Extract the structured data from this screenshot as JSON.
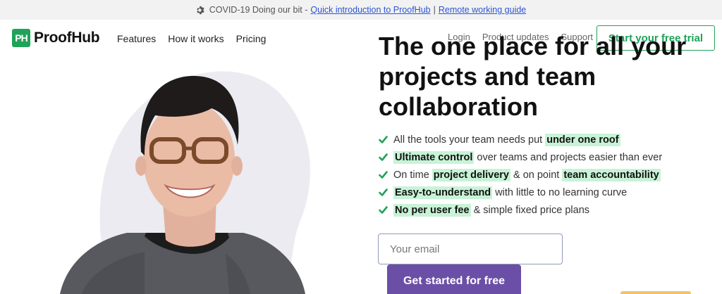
{
  "announcement": {
    "icon": "gear-icon",
    "text": "COVID-19 Doing our bit -",
    "link1": "Quick introduction to ProofHub",
    "separator": "|",
    "link2": "Remote working guide"
  },
  "brand": {
    "badge": "PH",
    "name": "ProofHub",
    "color": "#1fa35a"
  },
  "nav": {
    "items": [
      "Features",
      "How it works",
      "Pricing"
    ]
  },
  "right_nav": {
    "items": [
      "Login",
      "Product updates",
      "Support"
    ],
    "trial_button": "Start your free trial"
  },
  "hero": {
    "title": "The one place for all your projects and team collaboration",
    "features": [
      {
        "before": "All the tools your team needs put ",
        "highlight": "under one roof",
        "after": "",
        "highlight2": "",
        "after2": ""
      },
      {
        "before": "",
        "highlight": "Ultimate control",
        "after": " over teams and projects easier than ever",
        "highlight2": "",
        "after2": ""
      },
      {
        "before": "On time ",
        "highlight": "project delivery",
        "after": " & on point ",
        "highlight2": "team accountability",
        "after2": ""
      },
      {
        "before": "",
        "highlight": "Easy-to-understand",
        "after": " with little to no learning curve",
        "highlight2": "",
        "after2": ""
      },
      {
        "before": "",
        "highlight": "No per user fee",
        "after": " & simple fixed price plans",
        "highlight2": "",
        "after2": ""
      }
    ],
    "email_placeholder": "Your email",
    "cta": "Get started for free"
  },
  "colors": {
    "accent_green": "#1fa35a",
    "highlight": "#c8f3d6",
    "cta_purple": "#6b4fa7",
    "link_blue": "#2b55d4"
  }
}
